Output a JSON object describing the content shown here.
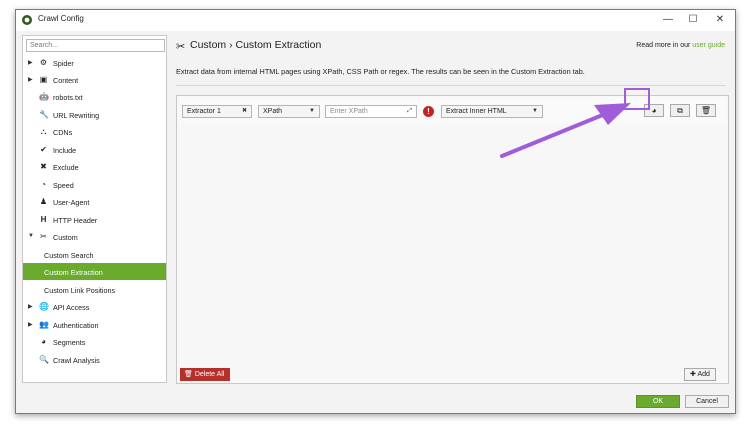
{
  "window": {
    "title": "Crawl Config",
    "minimize_icon": "minimize-icon",
    "maximize_icon": "maximize-icon",
    "close_icon": "close-icon"
  },
  "sidebar": {
    "search_placeholder": "Search...",
    "items": [
      {
        "label": "Spider",
        "icon": "gear-icon",
        "arrow": "▶"
      },
      {
        "label": "Content",
        "icon": "content-icon",
        "arrow": "▶"
      },
      {
        "label": "robots.txt",
        "icon": "robot-icon"
      },
      {
        "label": "URL Rewriting",
        "icon": "wrench-icon"
      },
      {
        "label": "CDNs",
        "icon": "network-icon"
      },
      {
        "label": "Include",
        "icon": "check-circle-icon"
      },
      {
        "label": "Exclude",
        "icon": "x-circle-icon"
      },
      {
        "label": "Speed",
        "icon": "gauge-icon"
      },
      {
        "label": "User-Agent",
        "icon": "user-agent-icon"
      },
      {
        "label": "HTTP Header",
        "icon": "header-icon"
      },
      {
        "label": "Custom",
        "icon": "tools-icon",
        "arrow": "▼"
      },
      {
        "label": "Custom Search",
        "sub": true
      },
      {
        "label": "Custom Extraction",
        "sub": true,
        "active": true
      },
      {
        "label": "Custom Link Positions",
        "sub": true
      },
      {
        "label": "API Access",
        "icon": "globe-icon",
        "arrow": "▶"
      },
      {
        "label": "Authentication",
        "icon": "users-icon",
        "arrow": "▶"
      },
      {
        "label": "Segments",
        "icon": "pie-chart-icon"
      },
      {
        "label": "Crawl Analysis",
        "icon": "search-icon"
      }
    ]
  },
  "main": {
    "breadcrumb": "Custom › Custom Extraction",
    "read_more_prefix": "Read more in our ",
    "read_more_link": "user guide",
    "description": "Extract data from internal HTML pages using XPath, CSS Path or regex. The results can be seen in the Custom Extraction tab."
  },
  "extractor": {
    "name": "Extractor 1",
    "type": "XPath",
    "xpath_placeholder": "Enter XPath",
    "extract_mode": "Extract Inner HTML"
  },
  "buttons": {
    "delete_all": "Delete All",
    "add": "Add",
    "ok": "OK",
    "cancel": "Cancel"
  },
  "colors": {
    "accent_green": "#6aab2e",
    "delete_red": "#b52f2b",
    "annotation_purple": "#a15cd8"
  }
}
